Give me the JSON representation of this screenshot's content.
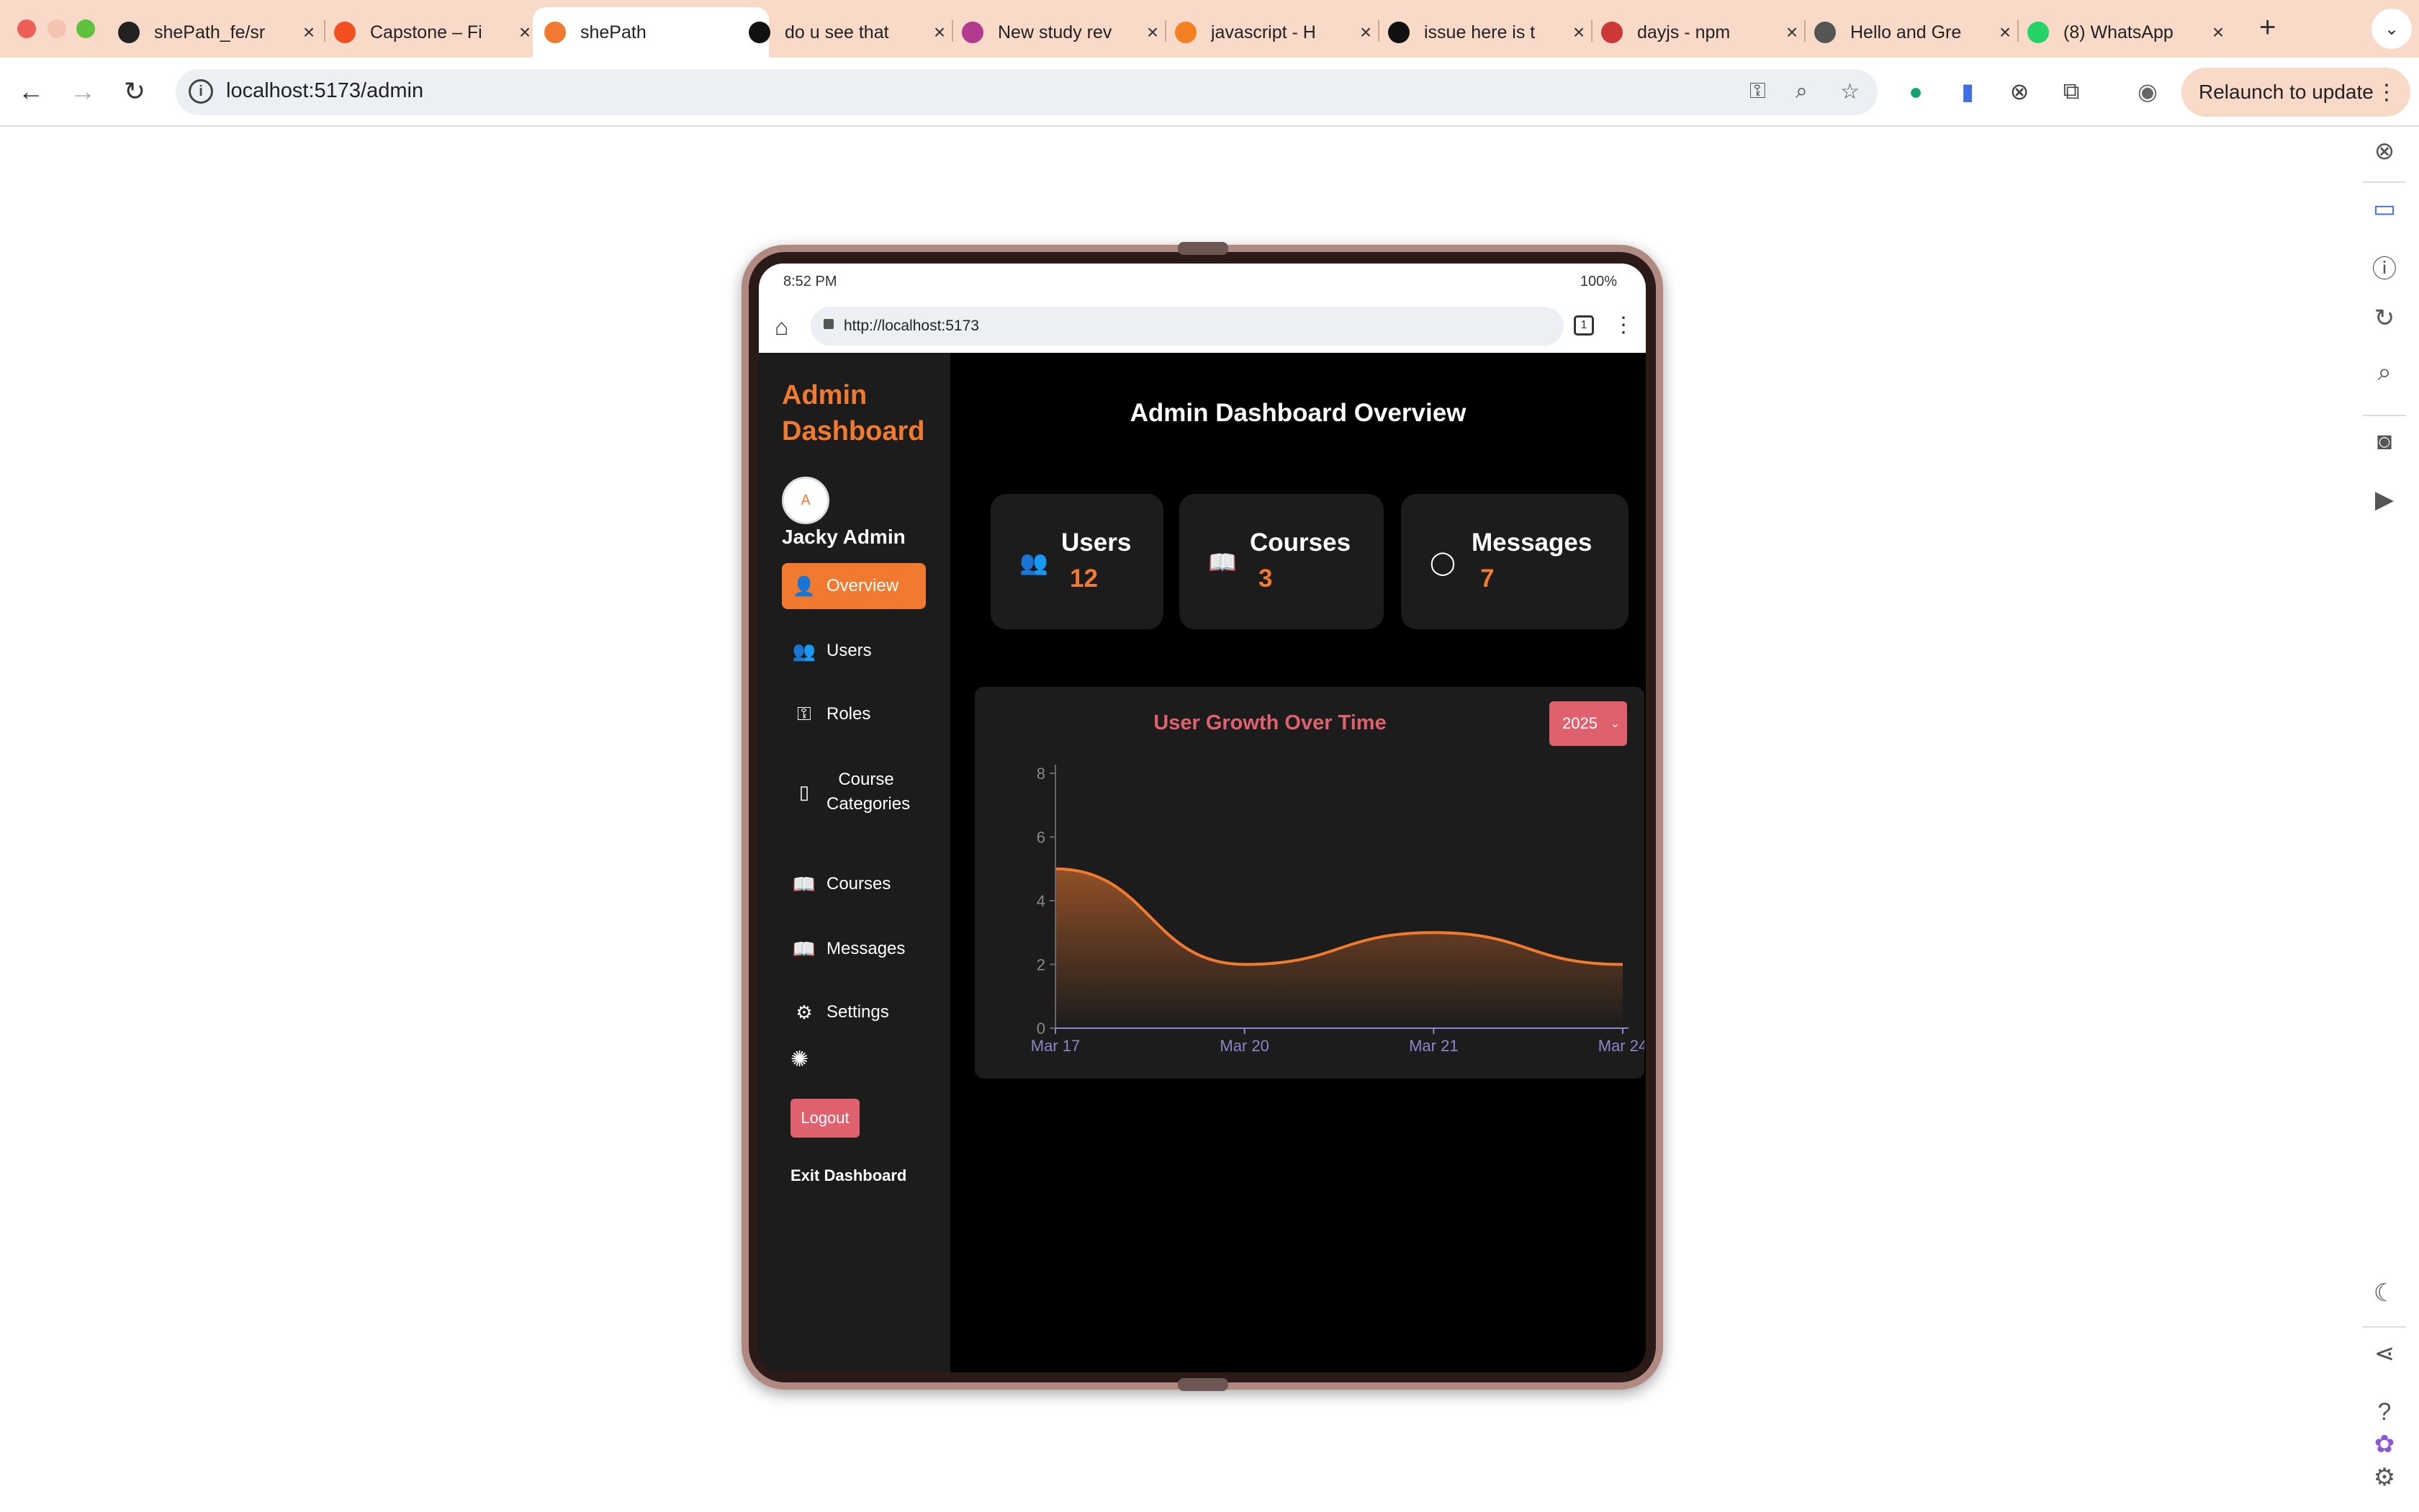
{
  "browser": {
    "tabs": [
      {
        "title": "shePath_fe/sr",
        "favicon": "github-icon",
        "color": "#222222",
        "active": false
      },
      {
        "title": "Capstone – Fi",
        "favicon": "figma-icon",
        "color": "#f24e1e",
        "active": false
      },
      {
        "title": "shePath",
        "favicon": "shepath-icon",
        "color": "#f07a30",
        "active": true
      },
      {
        "title": "do u see that",
        "favicon": "openai-icon",
        "color": "#111111",
        "active": false
      },
      {
        "title": "New study rev",
        "favicon": "study-icon",
        "color": "#b23a8f",
        "active": false
      },
      {
        "title": "javascript - H",
        "favicon": "stackoverflow-icon",
        "color": "#f48024",
        "active": false
      },
      {
        "title": "issue here is t",
        "favicon": "openai-icon",
        "color": "#111111",
        "active": false
      },
      {
        "title": "dayjs - npm",
        "favicon": "npm-icon",
        "color": "#cb3837",
        "active": false
      },
      {
        "title": "Hello and Gre",
        "favicon": "globe-icon",
        "color": "#555555",
        "active": false
      },
      {
        "title": "(8) WhatsApp",
        "favicon": "whatsapp-icon",
        "color": "#25d366",
        "active": false
      }
    ],
    "url": "localhost:5173/admin",
    "relaunch_label": "Relaunch to update"
  },
  "device": {
    "time": "8:52 PM",
    "battery": "100%",
    "url": "http://localhost:5173",
    "tab_count": "1"
  },
  "sidebar": {
    "brand": "Admin Dashboard",
    "user_name": "Jacky Admin",
    "avatar_text": "A",
    "items": [
      {
        "label": "Overview",
        "icon": "user-icon",
        "glyph": "👤",
        "active": true
      },
      {
        "label": "Users",
        "icon": "users-icon",
        "glyph": "👥",
        "active": false
      },
      {
        "label": "Roles",
        "icon": "key-icon",
        "glyph": "⚿",
        "active": false
      },
      {
        "label": "Course Categories",
        "icon": "book-icon",
        "glyph": "▯",
        "active": false
      },
      {
        "label": "Courses",
        "icon": "open-book-icon",
        "glyph": "📖",
        "active": false
      },
      {
        "label": "Messages",
        "icon": "open-book-icon",
        "glyph": "📖",
        "active": false
      },
      {
        "label": "Settings",
        "icon": "gear-icon",
        "glyph": "⚙",
        "active": false
      }
    ],
    "logout_label": "Logout",
    "exit_label": "Exit Dashboard"
  },
  "main": {
    "title": "Admin Dashboard Overview",
    "cards": [
      {
        "label": "Users",
        "value": "12",
        "icon": "users-icon"
      },
      {
        "label": "Courses",
        "value": "3",
        "icon": "open-book-icon"
      },
      {
        "label": "Messages",
        "value": "7",
        "icon": "chat-bubble-icon"
      }
    ]
  },
  "chart_data": {
    "type": "area",
    "title": "User Growth Over Time",
    "year": "2025",
    "categories": [
      "Mar 17",
      "Mar 20",
      "Mar 21",
      "Mar 24"
    ],
    "values": [
      5,
      2,
      3,
      2
    ],
    "ylim": [
      0,
      8
    ],
    "yticks": [
      0,
      2,
      4,
      6,
      8
    ],
    "grid": false,
    "line_color": "#f07a30"
  },
  "colors": {
    "accent": "#f07a30",
    "danger": "#e0616e",
    "panel": "#1c1c1c"
  }
}
